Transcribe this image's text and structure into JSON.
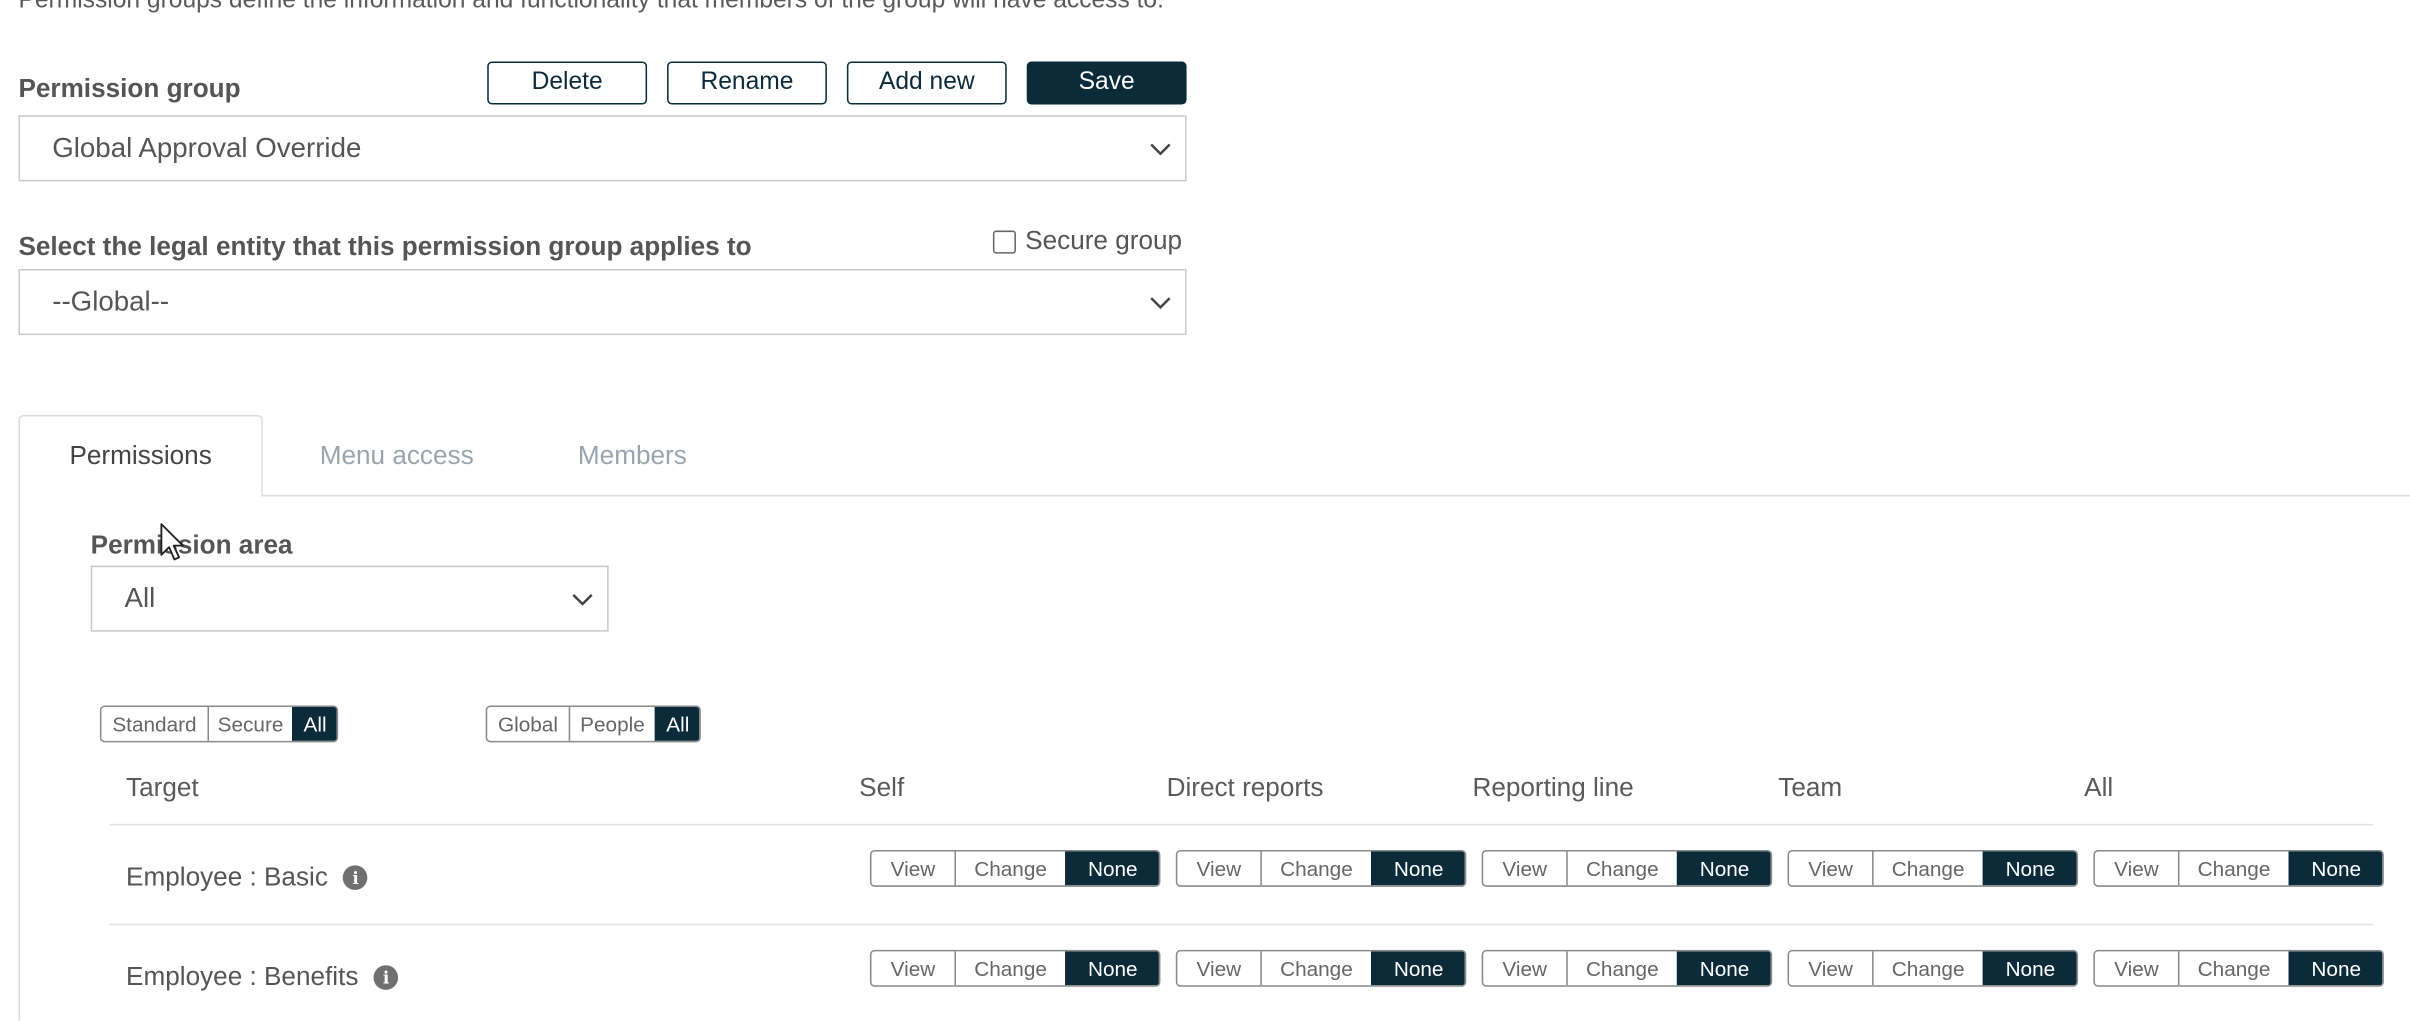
{
  "intro_text": "Permission groups define the information and functionality that members of the group will have access to.",
  "permission_group": {
    "label": "Permission group",
    "selected": "Global Approval Override",
    "buttons": {
      "delete": "Delete",
      "rename": "Rename",
      "add_new": "Add new",
      "save": "Save"
    }
  },
  "legal_entity": {
    "label": "Select the legal entity that this permission group applies to",
    "selected": "--Global--",
    "secure_group_label": "Secure group"
  },
  "tabs": [
    {
      "label": "Permissions",
      "active": true
    },
    {
      "label": "Menu access",
      "active": false
    },
    {
      "label": "Members",
      "active": false
    }
  ],
  "permission_area": {
    "label": "Permission area",
    "selected": "All"
  },
  "filters": {
    "type": {
      "options": [
        "Standard",
        "Secure",
        "All"
      ],
      "selected": "All"
    },
    "scope": {
      "options": [
        "Global",
        "People",
        "All"
      ],
      "selected": "All"
    }
  },
  "table": {
    "headers": [
      "Target",
      "Self",
      "Direct reports",
      "Reporting line",
      "Team",
      "All"
    ],
    "toggle_options": [
      "View",
      "Change",
      "None"
    ],
    "rows": [
      {
        "target": "Employee : Basic",
        "values": [
          "None",
          "None",
          "None",
          "None",
          "None"
        ]
      },
      {
        "target": "Employee : Benefits",
        "values": [
          "None",
          "None",
          "None",
          "None",
          "None"
        ]
      }
    ]
  },
  "colors": {
    "primary": "#0b2a3a",
    "tab_inactive": "#9aa4ad",
    "border": "#c9c9c9"
  },
  "icons": {
    "select_chevron": "chevron-down-icon",
    "info": "info-icon",
    "cursor": "mouse-pointer"
  }
}
